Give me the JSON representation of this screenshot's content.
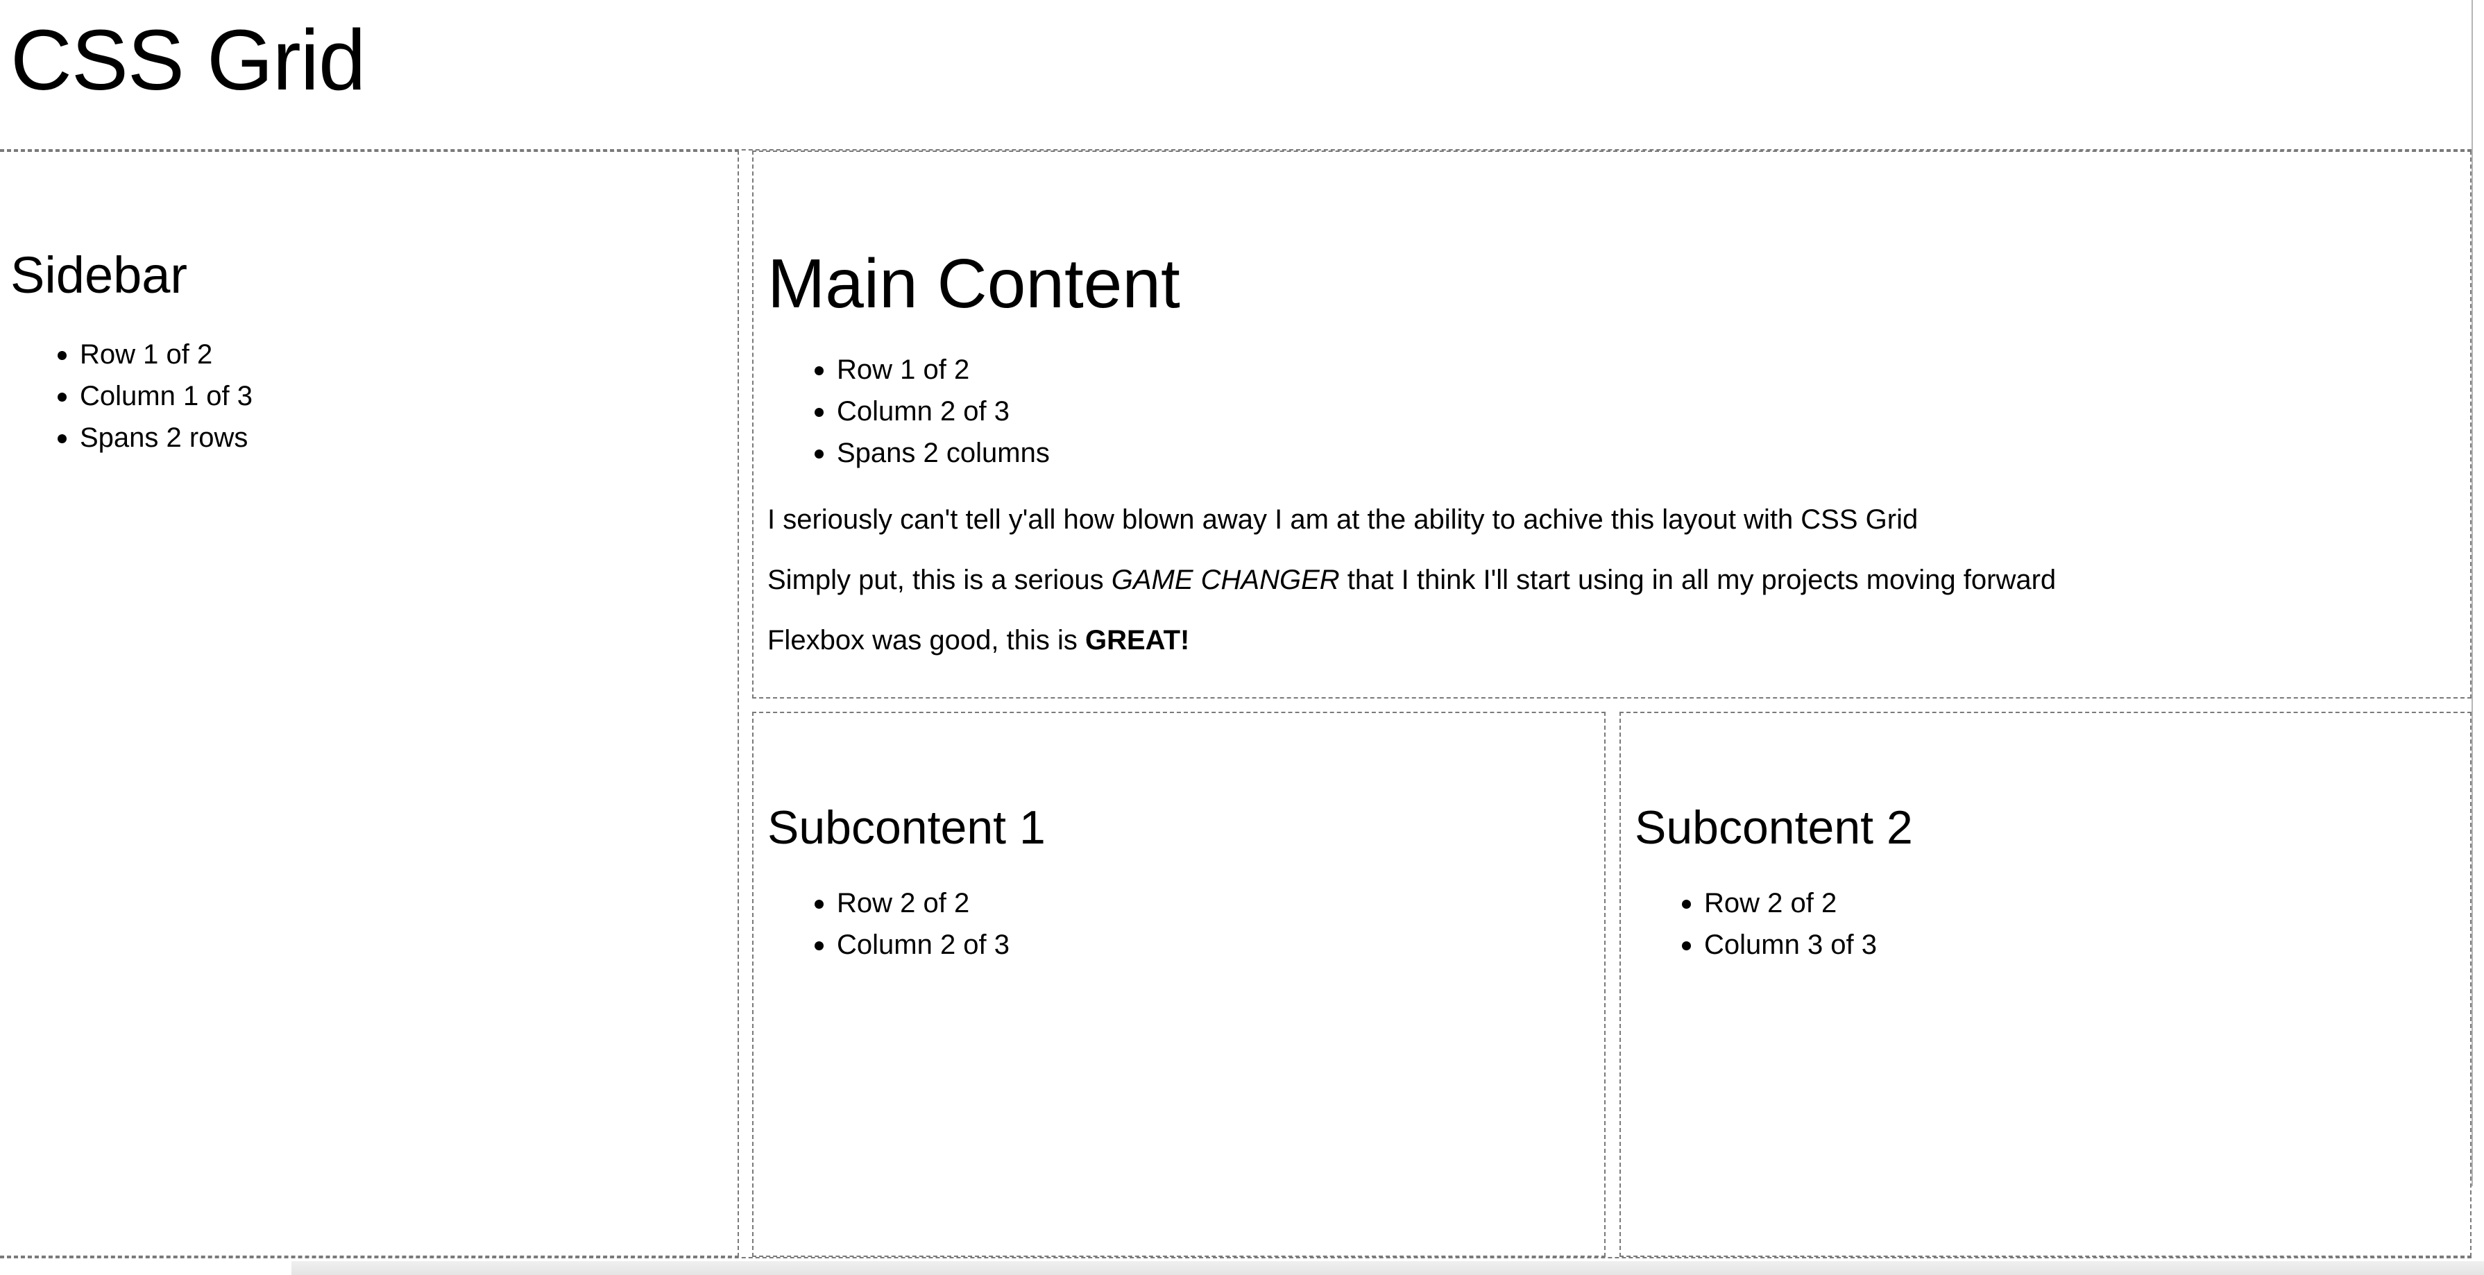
{
  "header": {
    "title": "CSS Grid"
  },
  "sidebar": {
    "title": "Sidebar",
    "items": [
      "Row 1 of 2",
      "Column 1 of 3",
      "Spans 2 rows"
    ]
  },
  "main": {
    "title": "Main Content",
    "items": [
      "Row 1 of 2",
      "Column 2 of 3",
      "Spans 2 columns"
    ],
    "paragraph1": "I seriously can't tell y'all how blown away I am at the ability to achive this layout with CSS Grid",
    "paragraph2_start": "Simply put, this is a serious ",
    "paragraph2_emphasis": "GAME CHANGER",
    "paragraph2_end": " that I think I'll start using in all my projects moving forward",
    "paragraph3_start": "Flexbox was good, this is ",
    "paragraph3_strong": "GREAT!"
  },
  "subcontent1": {
    "title": "Subcontent 1",
    "items": [
      "Row 2 of 2",
      "Column 2 of 3"
    ]
  },
  "subcontent2": {
    "title": "Subcontent 2",
    "items": [
      "Row 2 of 2",
      "Column 3 of 3"
    ]
  }
}
